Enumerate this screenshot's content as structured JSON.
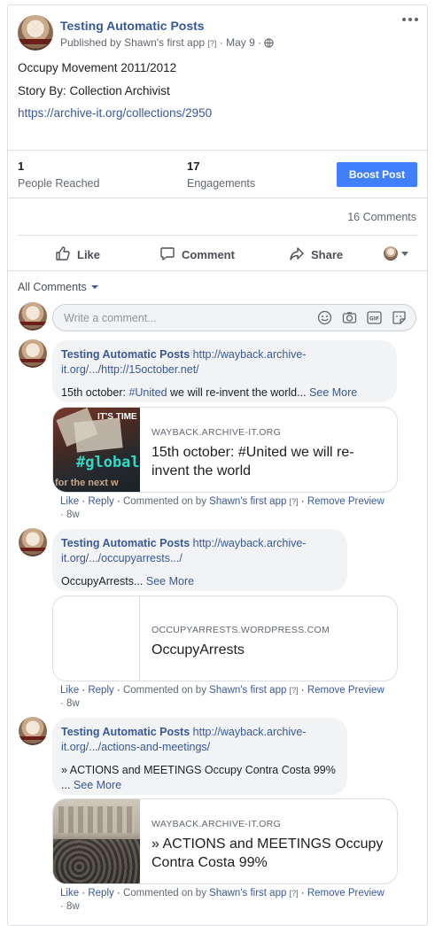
{
  "post": {
    "page_name": "Testing Automatic Posts",
    "published_by": "Published by",
    "app_name": "Shawn's first app",
    "help_mark": "[?]",
    "date": "May 9",
    "body_line1": "Occupy Movement 2011/2012",
    "body_line2": "Story By: Collection Archivist",
    "body_link": "https://archive-it.org/collections/2950"
  },
  "stats": {
    "reached_value": "1",
    "reached_label": "People Reached",
    "engagements_value": "17",
    "engagements_label": "Engagements",
    "boost_label": "Boost Post",
    "comments_count": "16 Comments"
  },
  "actions": {
    "like": "Like",
    "comment": "Comment",
    "share": "Share"
  },
  "comments_filter": "All Comments",
  "comment_input": {
    "placeholder": "Write a comment..."
  },
  "comments": [
    {
      "author": "Testing Automatic Posts",
      "link_line1": "http://wayback.archive-",
      "link_line2": "it.org/.../http://15october.net/",
      "text_pre": "15th october: ",
      "hashtag": "#United",
      "text_post": " we will re-invent the world...",
      "see_more": "See More",
      "preview_domain": "WAYBACK.ARCHIVE-IT.ORG",
      "preview_title": "15th october: #United we will re-invent the world",
      "thumb_text1": "IT'S TIME",
      "thumb_text2": "#global",
      "thumb_text3": "for the next w",
      "meta": {
        "like": "Like",
        "reply": "Reply",
        "commented": "Commented on by",
        "app": "Shawn's first app",
        "help": "[?]",
        "remove": "Remove Preview",
        "age": "8w"
      }
    },
    {
      "author": "Testing Automatic Posts",
      "link_line1": "http://wayback.archive-",
      "link_line2": "it.org/.../occupyarrests.../",
      "text_pre": "OccupyArrests...",
      "see_more": "See More",
      "preview_domain": "OCCUPYARRESTS.WORDPRESS.COM",
      "preview_title": "OccupyArrests",
      "meta": {
        "like": "Like",
        "reply": "Reply",
        "commented": "Commented on by",
        "app": "Shawn's first app",
        "help": "[?]",
        "remove": "Remove Preview",
        "age": "8w"
      }
    },
    {
      "author": "Testing Automatic Posts",
      "link_line1": "http://wayback.archive-",
      "link_line2": "it.org/.../actions-and-meetings/",
      "text_line1": "» ACTIONS and MEETINGS Occupy Contra Costa 99%",
      "text_line2": "...",
      "see_more": "See More",
      "preview_domain": "WAYBACK.ARCHIVE-IT.ORG",
      "preview_title": "» ACTIONS and MEETINGS Occupy Contra Costa 99%",
      "meta": {
        "like": "Like",
        "reply": "Reply",
        "commented": "Commented on by",
        "app": "Shawn's first app",
        "help": "[?]",
        "remove": "Remove Preview",
        "age": "8w"
      }
    }
  ],
  "colors": {
    "link": "#385898",
    "boost": "#4080ff",
    "muted": "#606770",
    "bubble": "#f2f3f5"
  },
  "icons": [
    "more-options-icon",
    "globe-icon",
    "like-thumb-icon",
    "comment-icon",
    "share-arrow-icon",
    "dropdown-caret-icon",
    "emoji-icon",
    "camera-icon",
    "gif-icon",
    "sticker-icon"
  ]
}
